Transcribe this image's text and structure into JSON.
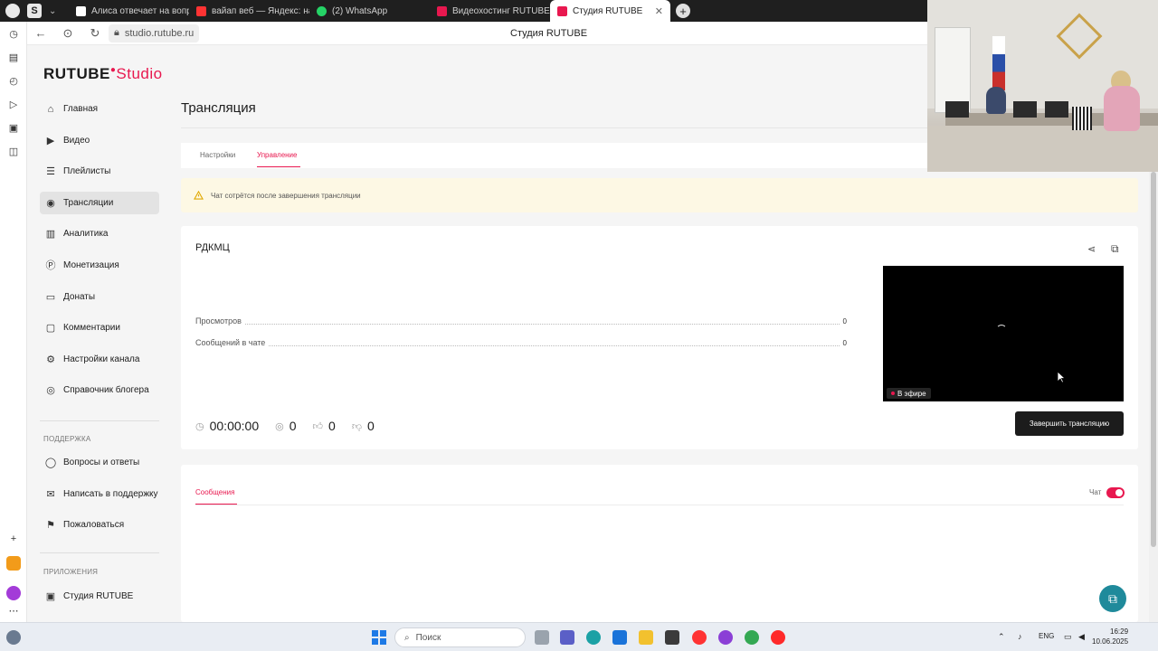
{
  "browser": {
    "tabs": [
      {
        "title": "Алиса отвечает на вопрос",
        "fav_color": "#ffffff"
      },
      {
        "title": "вайап веб — Яндекс: наш",
        "fav_color": "#ff3333"
      },
      {
        "title": "(2) WhatsApp",
        "fav_color": "#25d366"
      },
      {
        "title": "Видеохостинг RUTUBE. С",
        "fav_color": "#e8184f"
      },
      {
        "title": "Студия RUTUBE",
        "fav_color": "#e8184f"
      }
    ],
    "url": "studio.rutube.ru",
    "page_title": "Студия RUTUBE"
  },
  "logo": {
    "brand": "RUTUBE",
    "suffix": "Studio"
  },
  "sidebar": {
    "items": [
      {
        "label": "Главная",
        "icon": "home-icon"
      },
      {
        "label": "Видео",
        "icon": "video-icon"
      },
      {
        "label": "Плейлисты",
        "icon": "playlist-icon"
      },
      {
        "label": "Трансляции",
        "icon": "broadcast-icon"
      },
      {
        "label": "Аналитика",
        "icon": "analytics-icon"
      },
      {
        "label": "Монетизация",
        "icon": "monetization-icon"
      },
      {
        "label": "Донаты",
        "icon": "donations-icon"
      },
      {
        "label": "Комментарии",
        "icon": "comments-icon"
      },
      {
        "label": "Настройки канала",
        "icon": "channel-settings-icon"
      },
      {
        "label": "Справочник блогера",
        "icon": "handbook-icon"
      }
    ],
    "support_heading": "ПОДДЕРЖКА",
    "support_items": [
      {
        "label": "Вопросы и ответы",
        "icon": "faq-icon"
      },
      {
        "label": "Написать в поддержку",
        "icon": "mail-icon"
      },
      {
        "label": "Пожаловаться",
        "icon": "flag-icon"
      }
    ],
    "apps_heading": "ПРИЛОЖЕНИЯ",
    "apps_items": [
      {
        "label": "Студия RUTUBE",
        "icon": "studio-app-icon"
      }
    ]
  },
  "main": {
    "title": "Трансляция",
    "tabs": [
      "Настройки",
      "Управление"
    ],
    "active_tab": "Управление",
    "warning": "Чат сотрётся после завершения трансляции",
    "stream": {
      "name": "РДКМЦ",
      "rows": [
        {
          "label": "Просмотров",
          "value": "0"
        },
        {
          "label": "Сообщений в чате",
          "value": "0"
        }
      ],
      "live_badge": "В эфире",
      "timer": "00:00:00",
      "viewers": "0",
      "likes": "0",
      "dislikes": "0",
      "end_button": "Завершить трансляцию"
    },
    "messages": {
      "tab": "Сообщения",
      "chat_label": "Чат",
      "chat_enabled": true
    }
  },
  "taskbar": {
    "search_placeholder": "Поиск",
    "lang": "ENG",
    "time": "16:29",
    "date": "10.06.2025"
  },
  "colors": {
    "accent": "#e8184f",
    "warning_bg": "#fdf8e4",
    "end_button": "#1c1c1c"
  }
}
